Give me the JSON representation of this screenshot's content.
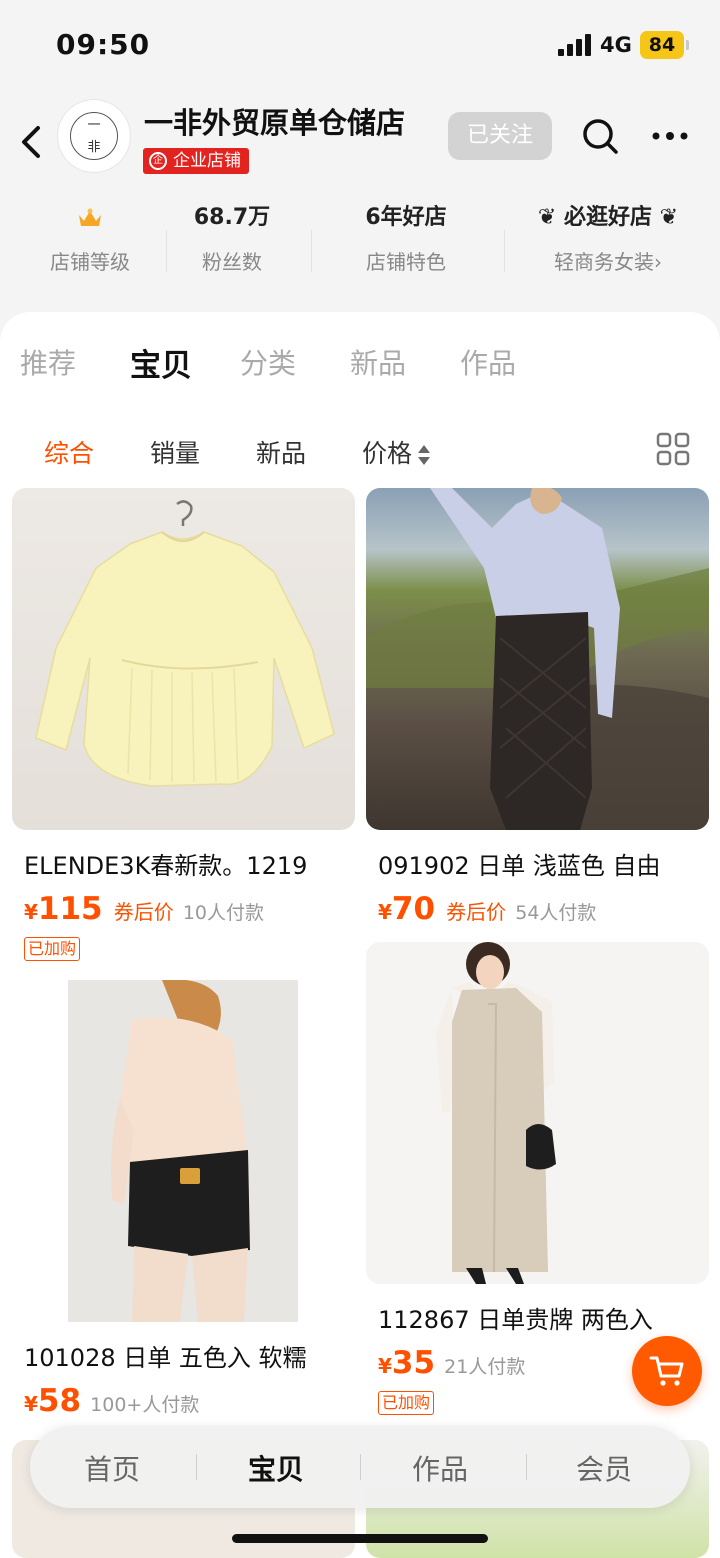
{
  "status": {
    "time": "09:50",
    "network": "4G",
    "battery": "84"
  },
  "shop": {
    "name": "一非外贸原单仓储店",
    "logo_text": "一\n非",
    "badge": "企业店铺",
    "follow_label": "已关注"
  },
  "stats": [
    {
      "value": "",
      "label": "店铺等级"
    },
    {
      "value": "68.7万",
      "label": "粉丝数"
    },
    {
      "value": "6年好店",
      "label": "店铺特色"
    },
    {
      "value": "必逛好店",
      "label": "轻商务女装›"
    }
  ],
  "tabs": [
    "推荐",
    "宝贝",
    "分类",
    "新品",
    "作品"
  ],
  "active_tab": "宝贝",
  "sorts": [
    "综合",
    "销量",
    "新品",
    "价格"
  ],
  "active_sort": "综合",
  "products": [
    {
      "title": "ELENDE3K春新款。1219",
      "yen": "¥",
      "price": "115",
      "coupon": "券后价",
      "paid": "10人付款",
      "tag": "已加购"
    },
    {
      "title": "091902 日单 浅蓝色 自由",
      "yen": "¥",
      "price": "70",
      "coupon": "券后价",
      "paid": "54人付款",
      "tag": ""
    },
    {
      "title": "101028 日单 五色入 软糯",
      "yen": "¥",
      "price": "58",
      "coupon": "",
      "paid": "100+人付款",
      "tag": ""
    },
    {
      "title": "112867 日单贵牌 两色入",
      "yen": "¥",
      "price": "35",
      "coupon": "",
      "paid": "21人付款",
      "tag": "已加购"
    }
  ],
  "bottom_nav": [
    "首页",
    "宝贝",
    "作品",
    "会员"
  ],
  "active_bottom": "宝贝",
  "colors": {
    "accent": "#ff5000",
    "badge_red": "#e32320",
    "battery": "#f5c518"
  }
}
